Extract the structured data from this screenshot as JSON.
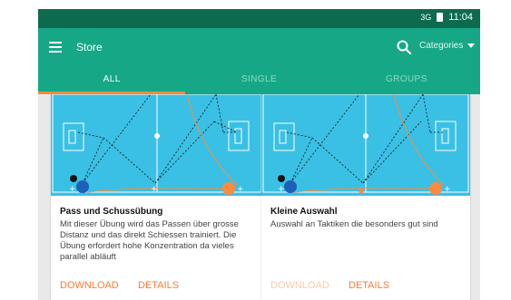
{
  "status_bar": {
    "signal": "3G",
    "time": "11:04"
  },
  "app_bar": {
    "title": "Store",
    "categories_label": "Categories"
  },
  "tabs": [
    {
      "label": "ALL",
      "active": true
    },
    {
      "label": "SINGLE",
      "active": false
    },
    {
      "label": "GROUPS",
      "active": false
    }
  ],
  "cards": [
    {
      "title": "Pass und Schussübung",
      "description": "Mit dieser Übung wird das Passen über grosse Distanz und das direkt Schiessen trainiert. Die Übung erfordert hohe Konzentration da vieles parallel abläuft",
      "download_label": "DOWNLOAD",
      "download_enabled": true,
      "details_label": "DETAILS"
    },
    {
      "title": "Kleine Auswahl",
      "description": "Auswahl an Taktiken die besonders gut sind",
      "download_label": "DOWNLOAD",
      "download_enabled": false,
      "details_label": "DETAILS"
    }
  ],
  "colors": {
    "status_bar": "#0c6b4e",
    "app_bar": "#16a886",
    "accent": "#ff8a3d",
    "pitch": "#3ac0e4",
    "player_blue": "#1e5fb8",
    "player_orange": "#ff8a3d"
  }
}
